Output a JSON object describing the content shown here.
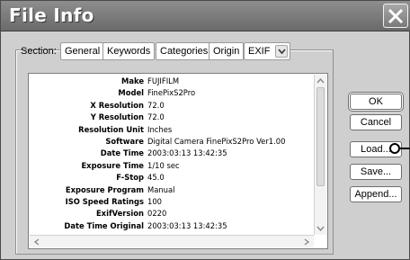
{
  "window": {
    "title": "File Info"
  },
  "section": {
    "label": "Section:",
    "tabs": [
      "General",
      "Keywords",
      "Categories",
      "Origin"
    ],
    "selected": "EXIF"
  },
  "exif_rows": [
    {
      "key": "Make",
      "value": "FUJIFILM"
    },
    {
      "key": "Model",
      "value": "FinePixS2Pro"
    },
    {
      "key": "X Resolution",
      "value": "72.0"
    },
    {
      "key": "Y Resolution",
      "value": "72.0"
    },
    {
      "key": "Resolution Unit",
      "value": "Inches"
    },
    {
      "key": "Software",
      "value": "Digital Camera FinePixS2Pro Ver1.00"
    },
    {
      "key": "Date Time",
      "value": "2003:03:13 13:42:35"
    },
    {
      "key": "Exposure Time",
      "value": "1/10 sec"
    },
    {
      "key": "F-Stop",
      "value": "45.0"
    },
    {
      "key": "Exposure Program",
      "value": "Manual"
    },
    {
      "key": "ISO Speed Ratings",
      "value": "100"
    },
    {
      "key": "ExifVersion",
      "value": "0220"
    },
    {
      "key": "Date Time Original",
      "value": "2003:03:13 13:42:35"
    }
  ],
  "buttons": {
    "ok": "OK",
    "cancel": "Cancel",
    "load": "Load...",
    "save": "Save...",
    "append": "Append..."
  },
  "icons": {
    "close": "close-icon",
    "dropdown": "chevron-down-icon",
    "scroll_up": "arrow-up-icon",
    "scroll_down": "arrow-down-icon",
    "scroll_left": "arrow-left-icon",
    "scroll_right": "arrow-right-icon"
  }
}
